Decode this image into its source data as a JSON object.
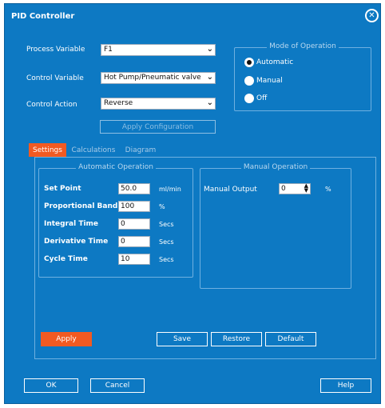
{
  "window": {
    "title": "PID Controller"
  },
  "config": {
    "process_variable": {
      "label": "Process Variable",
      "value": "F1"
    },
    "control_variable": {
      "label": "Control Variable",
      "value": "Hot Pump/Pneumatic valve"
    },
    "control_action": {
      "label": "Control Action",
      "value": "Reverse"
    },
    "apply_configuration": "Apply Configuration"
  },
  "mode": {
    "title": "Mode of Operation",
    "options": [
      "Automatic",
      "Manual",
      "Off"
    ],
    "selected": "Automatic"
  },
  "tabs": [
    "Settings",
    "Calculations",
    "Diagram"
  ],
  "automatic": {
    "title": "Automatic Operation",
    "fields": [
      {
        "label": "Set Point",
        "value": "50.0",
        "unit": "ml/min"
      },
      {
        "label": "Proportional Band",
        "value": "100",
        "unit": "%"
      },
      {
        "label": "Integral Time",
        "value": "0",
        "unit": "Secs"
      },
      {
        "label": "Derivative Time",
        "value": "0",
        "unit": "Secs"
      },
      {
        "label": "Cycle Time",
        "value": "10",
        "unit": "Secs"
      }
    ]
  },
  "manual": {
    "title": "Manual Operation",
    "output_label": "Manual Output",
    "output_value": "0",
    "output_unit": "%"
  },
  "buttons": {
    "apply": "Apply",
    "save": "Save",
    "restore": "Restore",
    "default": "Default",
    "ok": "OK",
    "cancel": "Cancel",
    "help": "Help"
  },
  "colors": {
    "window_bg": "#0d79c3",
    "accent_orange": "#f15a22"
  },
  "icons": {
    "close": "close-circle-icon",
    "dropdown": "chevron-down-icon"
  }
}
